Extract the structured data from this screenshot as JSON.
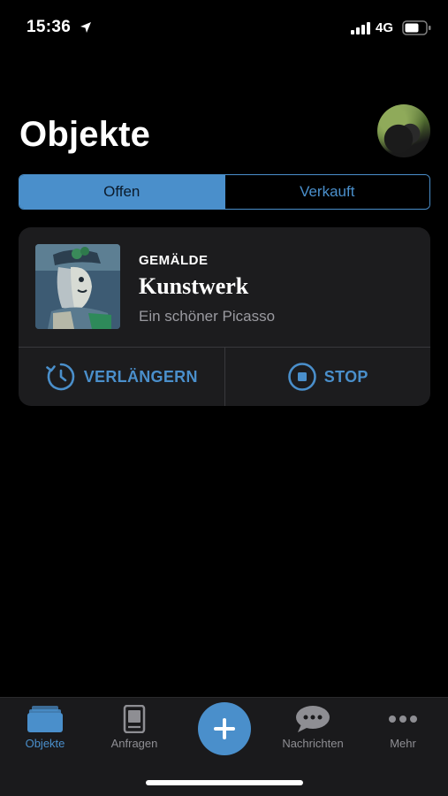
{
  "status_bar": {
    "time": "15:36",
    "network": "4G"
  },
  "header": {
    "title": "Objekte"
  },
  "segmented": {
    "tabs": [
      {
        "label": "Offen",
        "active": true
      },
      {
        "label": "Verkauft",
        "active": false
      }
    ]
  },
  "card": {
    "category": "GEMÄLDE",
    "title": "Kunstwerk",
    "subtitle": "Ein schöner Picasso",
    "actions": {
      "extend_label": "VERLÄNGERN",
      "stop_label": "STOP"
    }
  },
  "tab_bar": {
    "items": [
      {
        "label": "Objekte",
        "icon": "folder-icon",
        "active": true
      },
      {
        "label": "Anfragen",
        "icon": "tablet-icon",
        "active": false
      },
      {
        "label": "Nachrichten",
        "icon": "chat-bubble-icon",
        "active": false
      },
      {
        "label": "Mehr",
        "icon": "more-dots-icon",
        "active": false
      }
    ],
    "add_icon": "plus-icon"
  },
  "colors": {
    "accent": "#4a8fcb",
    "background": "#000000",
    "card": "#1c1c1e",
    "tab_bar": "#1a1a1c",
    "muted": "#8e8e93"
  }
}
